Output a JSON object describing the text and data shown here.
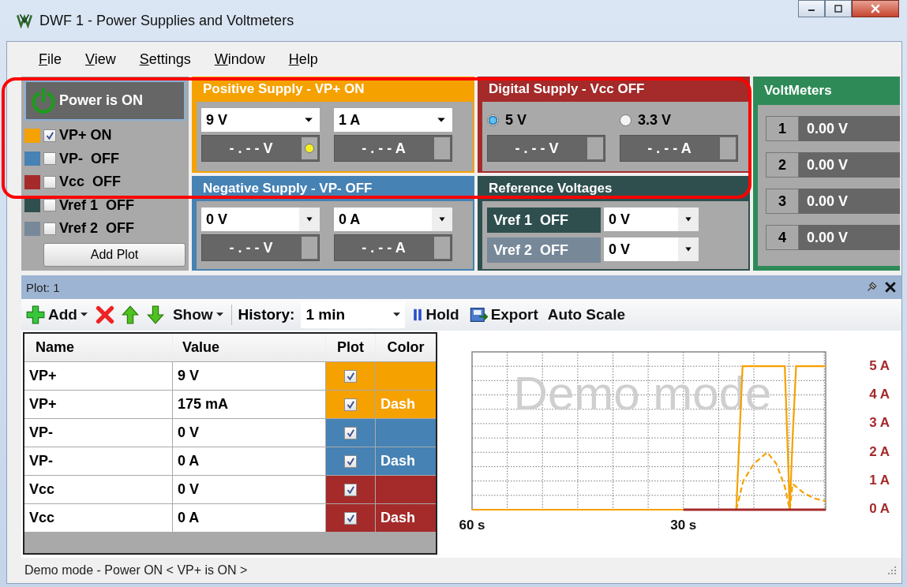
{
  "window": {
    "title": "DWF 1 - Power Supplies and Voltmeters"
  },
  "menu": [
    "File",
    "View",
    "Settings",
    "Window",
    "Help"
  ],
  "power": {
    "label": "Power is ON",
    "on": true
  },
  "channels": [
    {
      "label": "VP+ ON",
      "checked": true,
      "color": "#f5a100"
    },
    {
      "label": "VP-  OFF",
      "checked": false,
      "color": "#4682b4"
    },
    {
      "label": "Vcc  OFF",
      "checked": false,
      "color": "#a52a2a"
    },
    {
      "label": "Vref 1  OFF",
      "checked": false,
      "color": "#2f4f4f"
    },
    {
      "label": "Vref 2  OFF",
      "checked": false,
      "color": "#778899"
    }
  ],
  "add_plot": "Add Plot",
  "positive_supply": {
    "title": "Positive Supply - VP+ ON",
    "voltage": "9 V",
    "current": "1 A",
    "readings": [
      {
        "text": "- . - - V",
        "led": true
      },
      {
        "text": "- . - - A",
        "led": false
      }
    ]
  },
  "negative_supply": {
    "title": "Negative Supply - VP- OFF",
    "voltage": "0 V",
    "current": "0 A",
    "readings": [
      {
        "text": "- . - - V",
        "led": false
      },
      {
        "text": "- . - - A",
        "led": false
      }
    ]
  },
  "digital_supply": {
    "title": "Digital Supply - Vcc OFF",
    "options": [
      {
        "label": "5 V",
        "selected": true
      },
      {
        "label": "3.3 V",
        "selected": false
      }
    ],
    "readings": [
      {
        "text": "- . - - V",
        "led": false
      },
      {
        "text": "- . - - A",
        "led": false
      }
    ]
  },
  "reference_voltages": {
    "title": "Reference Voltages",
    "refs": [
      {
        "label": "Vref 1  OFF",
        "value": "0 V",
        "color": "#2f4f4f"
      },
      {
        "label": "Vref 2  OFF",
        "value": "0 V",
        "color": "#778899"
      }
    ]
  },
  "voltmeters": {
    "title": "VoltMeters",
    "meters": [
      {
        "index": "1",
        "value": "0.00 V"
      },
      {
        "index": "2",
        "value": "0.00 V"
      },
      {
        "index": "3",
        "value": "0.00 V"
      },
      {
        "index": "4",
        "value": "0.00 V"
      }
    ]
  },
  "plot": {
    "title": "Plot: 1",
    "toolbar": {
      "add": "Add",
      "show": "Show",
      "history_label": "History:",
      "history": "1 min",
      "hold": "Hold",
      "export": "Export",
      "autoscale": "Auto Scale"
    },
    "table": {
      "columns": [
        "Name",
        "Value",
        "Plot",
        "Color"
      ],
      "rows": [
        {
          "name": "VP+",
          "value": "9 V",
          "plot": true,
          "color": "#f5a100"
        },
        {
          "name": "VP+",
          "value": "175 mA",
          "plot": true,
          "color": "#f5a100",
          "style": "Dash"
        },
        {
          "name": "VP-",
          "value": "0 V",
          "plot": true,
          "color": "#4682b4"
        },
        {
          "name": "VP-",
          "value": "0 A",
          "plot": true,
          "color": "#4682b4",
          "style": "Dash"
        },
        {
          "name": "Vcc",
          "value": "0 V",
          "plot": true,
          "color": "#a52a2a"
        },
        {
          "name": "Vcc",
          "value": "0 A",
          "plot": true,
          "color": "#a52a2a",
          "style": "Dash"
        }
      ]
    },
    "chart_data": {
      "type": "line",
      "x": [
        60,
        30,
        22.5,
        21.6,
        21.5,
        20,
        18.1,
        16.8,
        15.6,
        14.9,
        14.5,
        14,
        13,
        11.5,
        9.8
      ],
      "series": [
        {
          "color": "#f5a100",
          "line_style": "solid",
          "values": [
            0,
            0,
            0,
            5,
            5,
            5,
            5,
            5,
            5,
            0,
            2.5,
            5,
            5,
            5,
            5
          ]
        },
        {
          "color": "#f5a100",
          "line_style": "dashed",
          "values": [
            null,
            null,
            0,
            0.9,
            1.0,
            1.6,
            2.0,
            1.6,
            0.8,
            0,
            0.9,
            0.8,
            0.6,
            0.4,
            0.3
          ]
        },
        {
          "color": "#a52a2a",
          "line_style": "solid",
          "values": [
            null,
            0,
            0,
            0,
            0,
            0,
            0,
            0,
            0,
            0,
            0,
            0,
            0,
            0,
            0
          ]
        }
      ],
      "xlim": [
        60,
        9.8
      ],
      "ylim": [
        0,
        5.5
      ],
      "grid": true,
      "xticks": [
        {
          "value": 60,
          "label": "60 s"
        },
        {
          "value": 30,
          "label": "30 s"
        }
      ],
      "yticks": [
        {
          "value": 0,
          "label": "0 A"
        },
        {
          "value": 1,
          "label": "1 A"
        },
        {
          "value": 2,
          "label": "2 A"
        },
        {
          "value": 3,
          "label": "3 A"
        },
        {
          "value": 4,
          "label": "4 A"
        },
        {
          "value": 5,
          "label": "5 A"
        }
      ],
      "annotations": [
        {
          "text": "Demo mode"
        }
      ]
    }
  },
  "status_bar": "Demo mode - Power ON < VP+ is ON >"
}
